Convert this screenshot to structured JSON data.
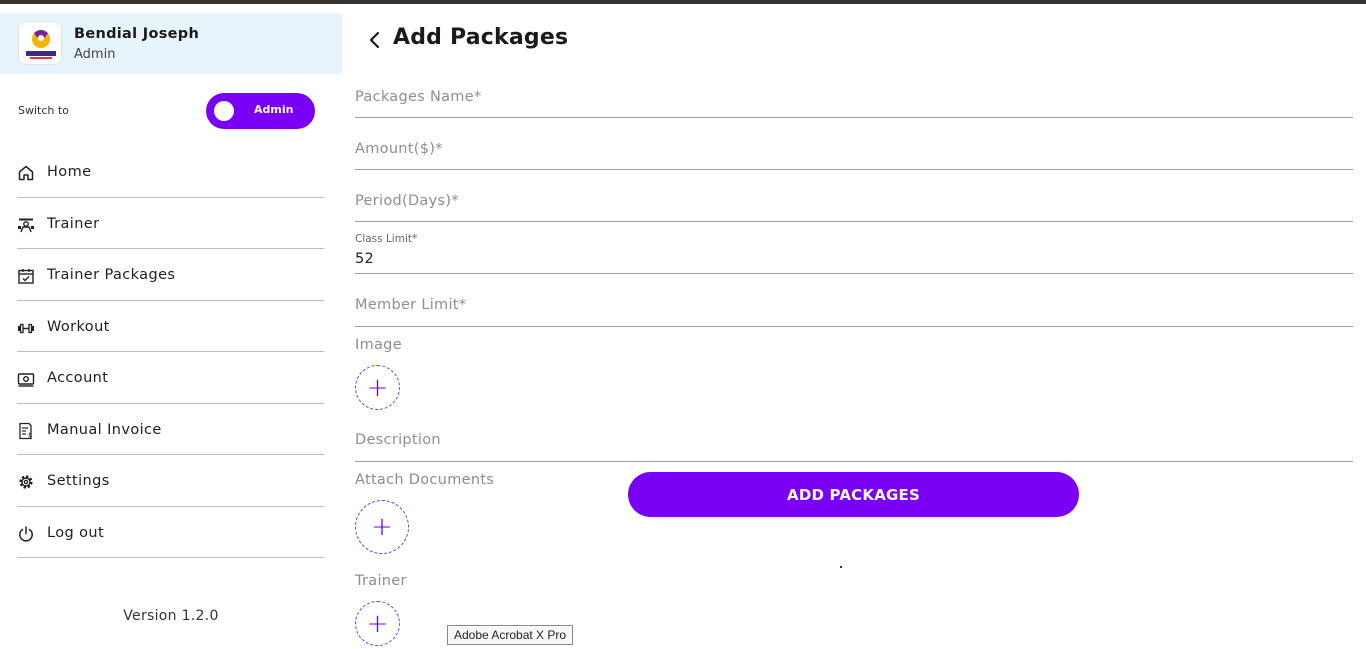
{
  "profile": {
    "name": "Bendial Joseph",
    "role": "Admin",
    "logo_icon": "crossfit-logo-icon"
  },
  "switch": {
    "label": "Switch to",
    "toggle_text": "Admin",
    "accent": "#7a00f5"
  },
  "nav": {
    "items": [
      {
        "label": "Home",
        "icon": "home-icon"
      },
      {
        "label": "Trainer",
        "icon": "trainer-icon"
      },
      {
        "label": "Trainer Packages",
        "icon": "calendar-check-icon"
      },
      {
        "label": "Workout",
        "icon": "dumbbell-icon"
      },
      {
        "label": "Account",
        "icon": "money-icon"
      },
      {
        "label": "Manual Invoice",
        "icon": "invoice-icon"
      },
      {
        "label": "Settings",
        "icon": "gear-icon"
      },
      {
        "label": "Log out",
        "icon": "power-icon"
      }
    ]
  },
  "version": "Version 1.2.0",
  "page": {
    "title": "Add Packages"
  },
  "form": {
    "package_name": {
      "placeholder": "Packages Name*",
      "value": ""
    },
    "amount": {
      "placeholder": "Amount($)*",
      "value": ""
    },
    "period": {
      "placeholder": "Period(Days)*",
      "value": ""
    },
    "class_limit": {
      "label": "Class Limit*",
      "value": "52"
    },
    "member_limit": {
      "placeholder": "Member Limit*",
      "value": ""
    },
    "image_label": "Image",
    "description": {
      "placeholder": "Description",
      "value": ""
    },
    "attach_label": "Attach Documents",
    "trainer_label": "Trainer",
    "submit_label": "ADD PACKAGES"
  },
  "tooltip": "Adobe Acrobat X Pro"
}
